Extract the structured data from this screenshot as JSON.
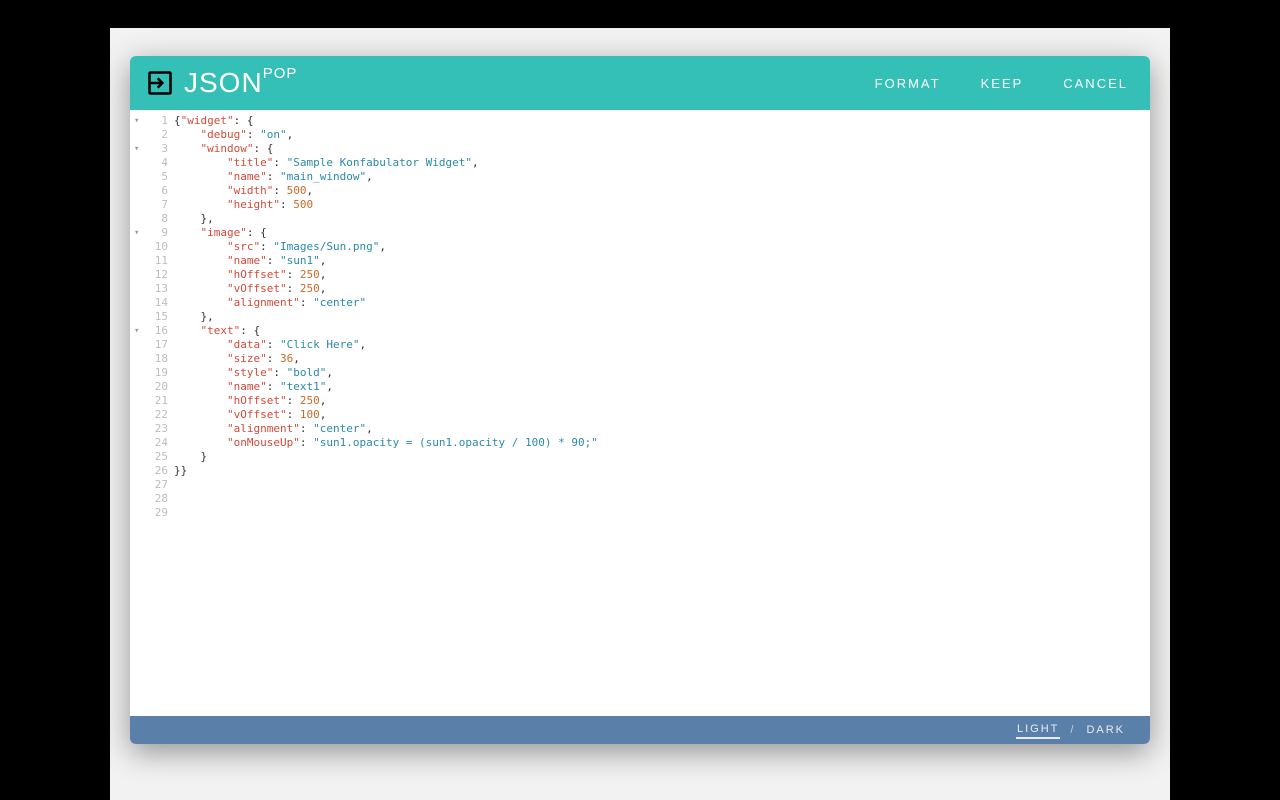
{
  "brand": {
    "main": "JSON",
    "sup": "POP"
  },
  "header": {
    "format": "FORMAT",
    "keep": "KEEP",
    "cancel": "CANCEL"
  },
  "footer": {
    "light": "LIGHT",
    "sep": "/",
    "dark": "DARK",
    "active": "light"
  },
  "foldable": [
    1,
    3,
    9,
    16
  ],
  "lines": [
    [
      {
        "t": "p",
        "v": "{"
      },
      {
        "t": "k",
        "v": "\"widget\""
      },
      {
        "t": "p",
        "v": ": {"
      }
    ],
    [
      {
        "t": "p",
        "v": "    "
      },
      {
        "t": "k",
        "v": "\"debug\""
      },
      {
        "t": "p",
        "v": ": "
      },
      {
        "t": "s",
        "v": "\"on\""
      },
      {
        "t": "p",
        "v": ","
      }
    ],
    [
      {
        "t": "p",
        "v": "    "
      },
      {
        "t": "k",
        "v": "\"window\""
      },
      {
        "t": "p",
        "v": ": {"
      }
    ],
    [
      {
        "t": "p",
        "v": "        "
      },
      {
        "t": "k",
        "v": "\"title\""
      },
      {
        "t": "p",
        "v": ": "
      },
      {
        "t": "s",
        "v": "\"Sample Konfabulator Widget\""
      },
      {
        "t": "p",
        "v": ","
      }
    ],
    [
      {
        "t": "p",
        "v": "        "
      },
      {
        "t": "k",
        "v": "\"name\""
      },
      {
        "t": "p",
        "v": ": "
      },
      {
        "t": "s",
        "v": "\"main_window\""
      },
      {
        "t": "p",
        "v": ","
      }
    ],
    [
      {
        "t": "p",
        "v": "        "
      },
      {
        "t": "k",
        "v": "\"width\""
      },
      {
        "t": "p",
        "v": ": "
      },
      {
        "t": "n",
        "v": "500"
      },
      {
        "t": "p",
        "v": ","
      }
    ],
    [
      {
        "t": "p",
        "v": "        "
      },
      {
        "t": "k",
        "v": "\"height\""
      },
      {
        "t": "p",
        "v": ": "
      },
      {
        "t": "n",
        "v": "500"
      }
    ],
    [
      {
        "t": "p",
        "v": "    },"
      }
    ],
    [
      {
        "t": "p",
        "v": "    "
      },
      {
        "t": "k",
        "v": "\"image\""
      },
      {
        "t": "p",
        "v": ": { "
      }
    ],
    [
      {
        "t": "p",
        "v": "        "
      },
      {
        "t": "k",
        "v": "\"src\""
      },
      {
        "t": "p",
        "v": ": "
      },
      {
        "t": "s",
        "v": "\"Images/Sun.png\""
      },
      {
        "t": "p",
        "v": ","
      }
    ],
    [
      {
        "t": "p",
        "v": "        "
      },
      {
        "t": "k",
        "v": "\"name\""
      },
      {
        "t": "p",
        "v": ": "
      },
      {
        "t": "s",
        "v": "\"sun1\""
      },
      {
        "t": "p",
        "v": ","
      }
    ],
    [
      {
        "t": "p",
        "v": "        "
      },
      {
        "t": "k",
        "v": "\"hOffset\""
      },
      {
        "t": "p",
        "v": ": "
      },
      {
        "t": "n",
        "v": "250"
      },
      {
        "t": "p",
        "v": ","
      }
    ],
    [
      {
        "t": "p",
        "v": "        "
      },
      {
        "t": "k",
        "v": "\"vOffset\""
      },
      {
        "t": "p",
        "v": ": "
      },
      {
        "t": "n",
        "v": "250"
      },
      {
        "t": "p",
        "v": ","
      }
    ],
    [
      {
        "t": "p",
        "v": "        "
      },
      {
        "t": "k",
        "v": "\"alignment\""
      },
      {
        "t": "p",
        "v": ": "
      },
      {
        "t": "s",
        "v": "\"center\""
      }
    ],
    [
      {
        "t": "p",
        "v": "    },"
      }
    ],
    [
      {
        "t": "p",
        "v": "    "
      },
      {
        "t": "k",
        "v": "\"text\""
      },
      {
        "t": "p",
        "v": ": {"
      }
    ],
    [
      {
        "t": "p",
        "v": "        "
      },
      {
        "t": "k",
        "v": "\"data\""
      },
      {
        "t": "p",
        "v": ": "
      },
      {
        "t": "s",
        "v": "\"Click Here\""
      },
      {
        "t": "p",
        "v": ","
      }
    ],
    [
      {
        "t": "p",
        "v": "        "
      },
      {
        "t": "k",
        "v": "\"size\""
      },
      {
        "t": "p",
        "v": ": "
      },
      {
        "t": "n",
        "v": "36"
      },
      {
        "t": "p",
        "v": ","
      }
    ],
    [
      {
        "t": "p",
        "v": "        "
      },
      {
        "t": "k",
        "v": "\"style\""
      },
      {
        "t": "p",
        "v": ": "
      },
      {
        "t": "s",
        "v": "\"bold\""
      },
      {
        "t": "p",
        "v": ","
      }
    ],
    [
      {
        "t": "p",
        "v": "        "
      },
      {
        "t": "k",
        "v": "\"name\""
      },
      {
        "t": "p",
        "v": ": "
      },
      {
        "t": "s",
        "v": "\"text1\""
      },
      {
        "t": "p",
        "v": ","
      }
    ],
    [
      {
        "t": "p",
        "v": "        "
      },
      {
        "t": "k",
        "v": "\"hOffset\""
      },
      {
        "t": "p",
        "v": ": "
      },
      {
        "t": "n",
        "v": "250"
      },
      {
        "t": "p",
        "v": ","
      }
    ],
    [
      {
        "t": "p",
        "v": "        "
      },
      {
        "t": "k",
        "v": "\"vOffset\""
      },
      {
        "t": "p",
        "v": ": "
      },
      {
        "t": "n",
        "v": "100"
      },
      {
        "t": "p",
        "v": ","
      }
    ],
    [
      {
        "t": "p",
        "v": "        "
      },
      {
        "t": "k",
        "v": "\"alignment\""
      },
      {
        "t": "p",
        "v": ": "
      },
      {
        "t": "s",
        "v": "\"center\""
      },
      {
        "t": "p",
        "v": ","
      }
    ],
    [
      {
        "t": "p",
        "v": "        "
      },
      {
        "t": "k",
        "v": "\"onMouseUp\""
      },
      {
        "t": "p",
        "v": ": "
      },
      {
        "t": "s",
        "v": "\"sun1.opacity = (sun1.opacity / 100) * 90;\""
      }
    ],
    [
      {
        "t": "p",
        "v": "    }"
      }
    ],
    [
      {
        "t": "p",
        "v": "}}"
      }
    ],
    [],
    [],
    []
  ]
}
